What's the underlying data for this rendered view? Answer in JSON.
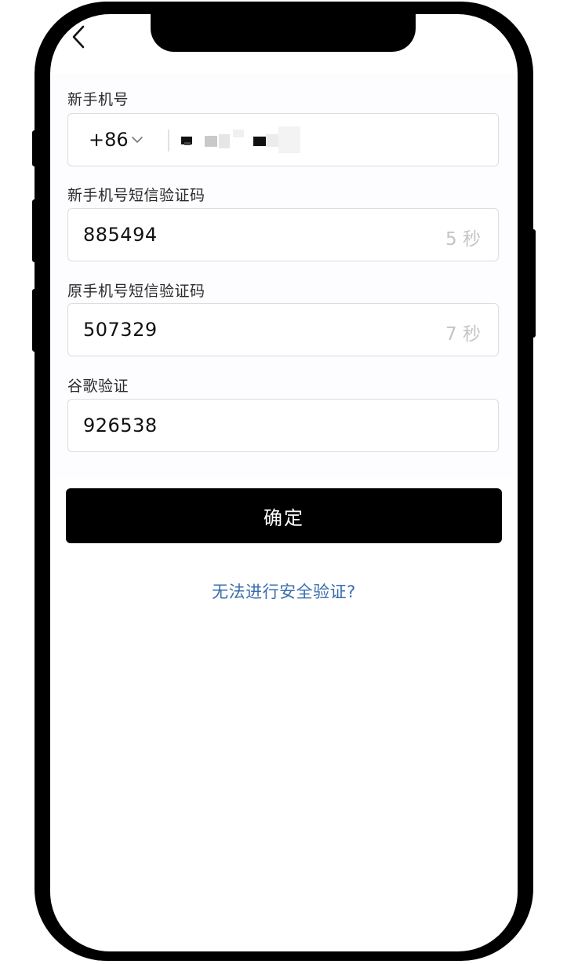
{
  "form": {
    "new_phone": {
      "label": "新手机号",
      "country_code": "+86"
    },
    "new_phone_sms": {
      "label": "新手机号短信验证码",
      "value": "885494",
      "timer": "5 秒"
    },
    "old_phone_sms": {
      "label": "原手机号短信验证码",
      "value": "507329",
      "timer": "7 秒"
    },
    "google_auth": {
      "label": "谷歌验证",
      "value": "926538"
    }
  },
  "actions": {
    "confirm_label": "确定",
    "help_link": "无法进行安全验证?"
  },
  "icons": {
    "back": "chevron-left-icon",
    "country_dropdown": "chevron-down-icon"
  },
  "colors": {
    "primary_button": "#000000",
    "link": "#3a6dad",
    "timer_text": "#c4c4c4"
  }
}
